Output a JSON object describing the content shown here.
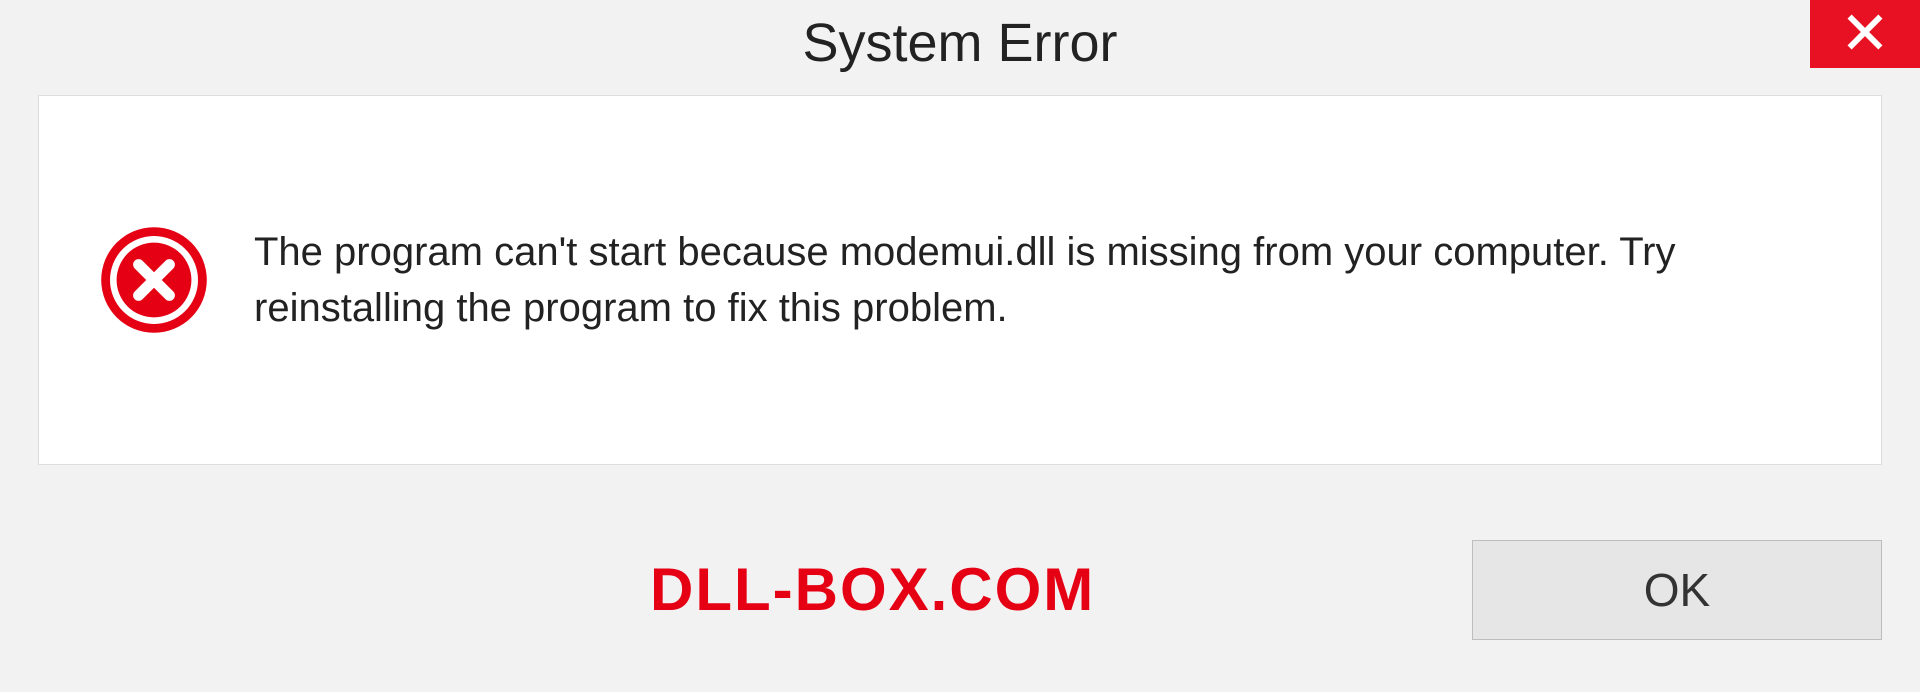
{
  "dialog": {
    "title": "System Error",
    "message": "The program can't start because modemui.dll is missing from your computer. Try reinstalling the program to fix this problem.",
    "ok_label": "OK"
  },
  "watermark": "DLL-BOX.COM",
  "colors": {
    "close_bg": "#e81123",
    "error_icon": "#e60014",
    "watermark": "#e60014"
  }
}
